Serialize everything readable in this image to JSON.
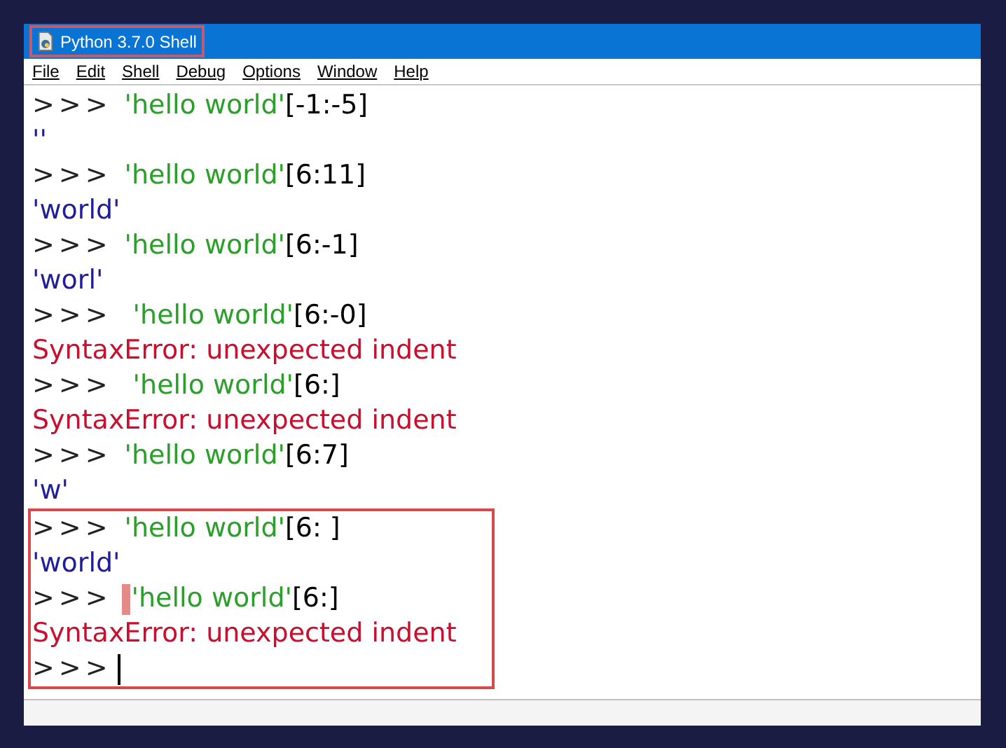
{
  "window": {
    "title": "Python 3.7.0 Shell"
  },
  "menu": [
    {
      "label": "File"
    },
    {
      "label": "Edit"
    },
    {
      "label": "Shell"
    },
    {
      "label": "Debug"
    },
    {
      "label": "Options"
    },
    {
      "label": "Window"
    },
    {
      "label": "Help"
    }
  ],
  "lines": [
    {
      "kind": "input",
      "prompt": ">>>",
      "string": "'hello world'",
      "rest": "[-1:-5]"
    },
    {
      "kind": "output",
      "text": "''"
    },
    {
      "kind": "input",
      "prompt": ">>>",
      "string": "'hello world'",
      "rest": "[6:11]"
    },
    {
      "kind": "output",
      "text": "'world'"
    },
    {
      "kind": "input",
      "prompt": ">>>",
      "string": "'hello world'",
      "rest": "[6:-1]"
    },
    {
      "kind": "output",
      "text": "'worl'"
    },
    {
      "kind": "input",
      "prompt": ">>>",
      "string": " 'hello world'",
      "rest": "[6:-0]"
    },
    {
      "kind": "error",
      "text": "SyntaxError: unexpected indent"
    },
    {
      "kind": "input",
      "prompt": ">>>",
      "string": " 'hello world'",
      "rest": "[6:]"
    },
    {
      "kind": "error",
      "text": "SyntaxError: unexpected indent"
    },
    {
      "kind": "input",
      "prompt": ">>>",
      "string": "'hello world'",
      "rest": "[6:7]"
    },
    {
      "kind": "output",
      "text": "'w'"
    }
  ],
  "annotated_lines": [
    {
      "kind": "input",
      "prompt": ">>>",
      "string": "'hello world'",
      "rest": "[6: ]"
    },
    {
      "kind": "output",
      "text": "'world'"
    },
    {
      "kind": "input",
      "prompt": ">>>",
      "string": "'hello world'",
      "rest": "[6:]",
      "marked": true
    },
    {
      "kind": "error",
      "text": "SyntaxError: unexpected indent"
    },
    {
      "kind": "prompt",
      "prompt": ">>>",
      "cursor": true
    }
  ]
}
